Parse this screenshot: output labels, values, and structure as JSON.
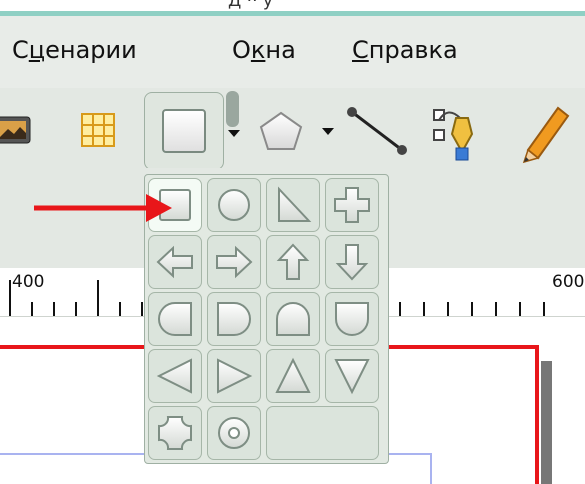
{
  "window": {
    "title_fragment": "Д ·· у"
  },
  "menubar": {
    "items": [
      {
        "label_pre": "С",
        "label_acc": "ц",
        "label_post": "енарии"
      },
      {
        "label_pre": "О",
        "label_acc": "к",
        "label_post": "на"
      },
      {
        "label_pre": "",
        "label_acc": "С",
        "label_post": "правка"
      }
    ]
  },
  "toolbar": {
    "tools": [
      "image-frame-icon",
      "table-icon",
      "rectangle-shape-icon",
      "polygon-icon",
      "line-icon",
      "bezier-pen-icon",
      "pencil-icon"
    ]
  },
  "shape_popup": {
    "shapes": [
      "rectangle",
      "ellipse",
      "right-triangle",
      "cross",
      "arrow-left",
      "arrow-right",
      "arrow-up",
      "arrow-down",
      "half-round-left",
      "half-round-right",
      "arch",
      "shield",
      "triangle-left",
      "triangle-right",
      "triangle-up",
      "triangle-down",
      "octagon-rounded",
      "donut"
    ],
    "selected": "rectangle"
  },
  "annotation": {
    "arrow_color": "#e8161a"
  },
  "ruler": {
    "labels": [
      "400",
      "600"
    ]
  },
  "colors": {
    "accent_teal": "#8fd0c4",
    "frame_red": "#e8161a",
    "guide_blue": "#a9b3f0"
  }
}
